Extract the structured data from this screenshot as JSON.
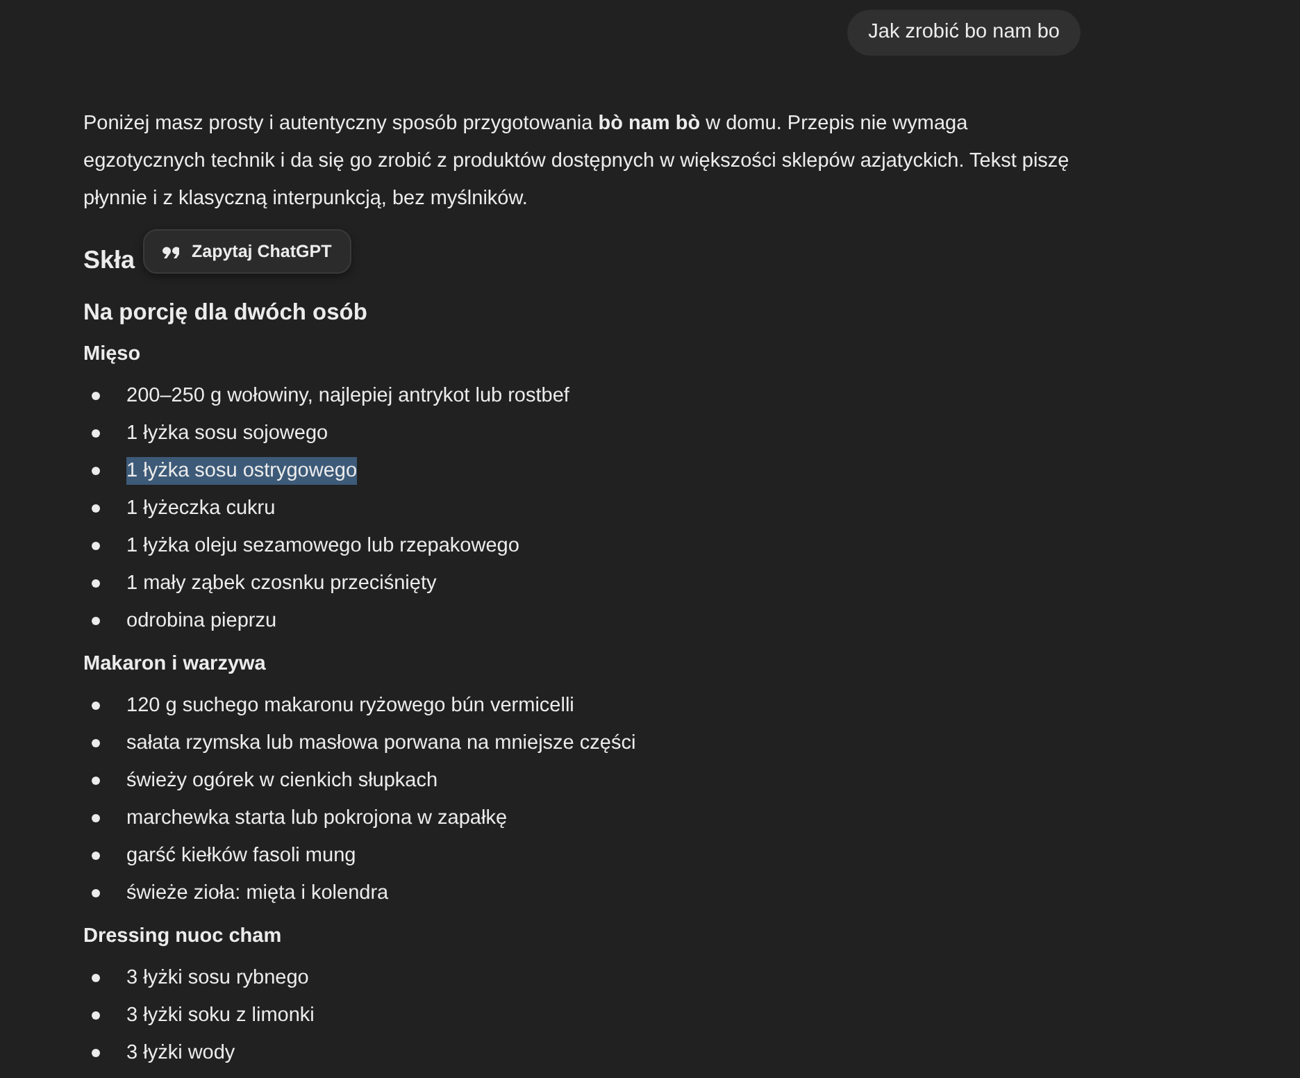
{
  "user_message": {
    "text": "Jak zrobić bo nam bo"
  },
  "answer": {
    "intro": "Poniżej masz prosty i autentyczny sposób przygotowania **bò nam bò** w domu. Przepis nie wymaga egzotycznych technik i da się go zrobić z produktów dostępnych w większości sklepów azjatyckich. Tekst piszę płynnie i z klasyczną interpunkcją, bez myślników.",
    "heading": "Skła",
    "subheading": "Na porcję dla dwóch osób",
    "sections": [
      {
        "title": "Mięso",
        "items": [
          {
            "text": "200–250 g wołowiny, najlepiej antrykot lub rostbef",
            "selected": false
          },
          {
            "text": "1 łyżka sosu sojowego",
            "selected": false
          },
          {
            "text": "1 łyżka sosu ostrygowego",
            "selected": true
          },
          {
            "text": "1 łyżeczka cukru",
            "selected": false
          },
          {
            "text": "1 łyżka oleju sezamowego lub rzepakowego",
            "selected": false
          },
          {
            "text": "1 mały ząbek czosnku przeciśnięty",
            "selected": false
          },
          {
            "text": "odrobina pieprzu",
            "selected": false
          }
        ]
      },
      {
        "title": "Makaron i warzywa",
        "items": [
          {
            "text": "120 g suchego makaronu ryżowego bún vermicelli",
            "selected": false
          },
          {
            "text": "sałata rzymska lub masłowa porwana na mniejsze części",
            "selected": false
          },
          {
            "text": "świeży ogórek w cienkich słupkach",
            "selected": false
          },
          {
            "text": "marchewka starta lub pokrojona w zapałkę",
            "selected": false
          },
          {
            "text": "garść kiełków fasoli mung",
            "selected": false
          },
          {
            "text": "świeże zioła: mięta i kolendra",
            "selected": false
          }
        ]
      },
      {
        "title": "Dressing nuoc cham",
        "items": [
          {
            "text": "3 łyżki sosu rybnego",
            "selected": false
          },
          {
            "text": "3 łyżki soku z limonki",
            "selected": false
          },
          {
            "text": "3 łyżki wody",
            "selected": false
          }
        ]
      }
    ]
  },
  "selection_popup": {
    "label": "Zapytaj ChatGPT"
  }
}
